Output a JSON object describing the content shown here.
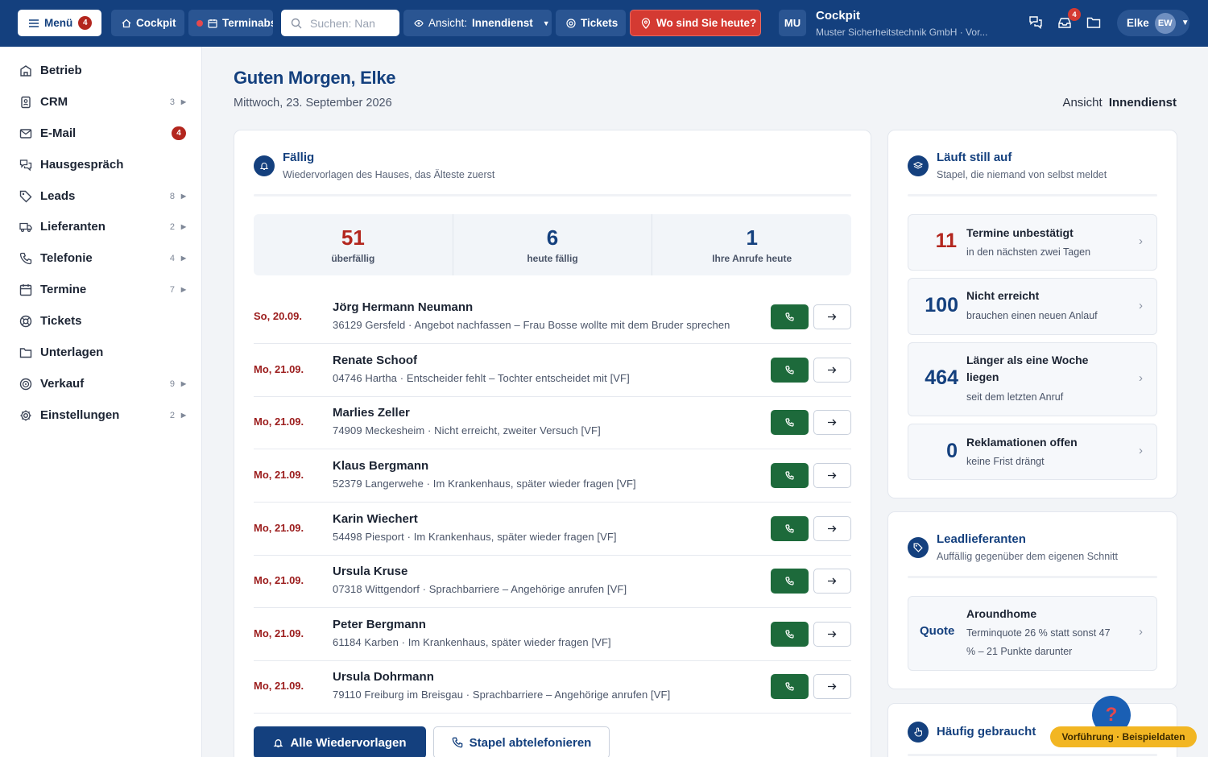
{
  "topbar": {
    "menu_label": "Menü",
    "menu_badge": "4",
    "cockpit_label": "Cockpit",
    "terminals_label": "Terminabs",
    "search_placeholder": "Suchen: Nan",
    "view_prefix": "Ansicht:",
    "view_value": "Innendienst",
    "tickets_label": "Tickets",
    "where_label": "Wo sind Sie heute?",
    "brand_initials": "MU",
    "brand_title": "Cockpit",
    "brand_subtitle": "Muster Sicherheitstechnik GmbH · Vor...",
    "inbox_badge": "4",
    "user_name": "Elke",
    "user_initials": "EW",
    "accent_color": "#14407e",
    "alert_color": "#d43a32"
  },
  "sidebar": {
    "items": [
      {
        "label": "Betrieb",
        "icon": "building-icon",
        "count": "",
        "badge": ""
      },
      {
        "label": "CRM",
        "icon": "contacts-icon",
        "count": "3",
        "badge": ""
      },
      {
        "label": "E-Mail",
        "icon": "mail-icon",
        "count": "",
        "badge": "4"
      },
      {
        "label": "Hausgespräch",
        "icon": "chat-icon",
        "count": "",
        "badge": ""
      },
      {
        "label": "Leads",
        "icon": "tag-icon",
        "count": "8",
        "badge": ""
      },
      {
        "label": "Lieferanten",
        "icon": "truck-icon",
        "count": "2",
        "badge": ""
      },
      {
        "label": "Telefonie",
        "icon": "phone-icon",
        "count": "4",
        "badge": ""
      },
      {
        "label": "Termine",
        "icon": "calendar-icon",
        "count": "7",
        "badge": ""
      },
      {
        "label": "Tickets",
        "icon": "lifebuoy-icon",
        "count": "",
        "badge": ""
      },
      {
        "label": "Unterlagen",
        "icon": "folder-icon",
        "count": "",
        "badge": ""
      },
      {
        "label": "Verkauf",
        "icon": "target-icon",
        "count": "9",
        "badge": ""
      },
      {
        "label": "Einstellungen",
        "icon": "gear-icon",
        "count": "2",
        "badge": ""
      }
    ]
  },
  "main": {
    "greeting": "Guten Morgen, Elke",
    "date": "Mittwoch, 23. September 2026",
    "view_label": "Ansicht",
    "view_value": "Innendienst"
  },
  "due": {
    "title": "Fällig",
    "subtitle": "Wiedervorlagen des Hauses, das Älteste zuerst",
    "stats": [
      {
        "value": "51",
        "label": "überfällig"
      },
      {
        "value": "6",
        "label": "heute fällig"
      },
      {
        "value": "1",
        "label": "Ihre Anrufe heute"
      }
    ],
    "rows": [
      {
        "date": "So, 20.09.",
        "name": "Jörg Hermann Neumann",
        "desc": "36129 Gersfeld · Angebot nachfassen – Frau Bosse wollte mit dem Bruder sprechen"
      },
      {
        "date": "Mo, 21.09.",
        "name": "Renate Schoof",
        "desc": "04746 Hartha · Entscheider fehlt – Tochter entscheidet mit [VF]"
      },
      {
        "date": "Mo, 21.09.",
        "name": "Marlies Zeller",
        "desc": "74909 Meckesheim · Nicht erreicht, zweiter Versuch [VF]"
      },
      {
        "date": "Mo, 21.09.",
        "name": "Klaus Bergmann",
        "desc": "52379 Langerwehe · Im Krankenhaus, später wieder fragen [VF]"
      },
      {
        "date": "Mo, 21.09.",
        "name": "Karin Wiechert",
        "desc": "54498 Piesport · Im Krankenhaus, später wieder fragen [VF]"
      },
      {
        "date": "Mo, 21.09.",
        "name": "Ursula Kruse",
        "desc": "07318 Wittgendorf · Sprachbarriere – Angehörige anrufen [VF]"
      },
      {
        "date": "Mo, 21.09.",
        "name": "Peter Bergmann",
        "desc": "61184 Karben · Im Krankenhaus, später wieder fragen [VF]"
      },
      {
        "date": "Mo, 21.09.",
        "name": "Ursula Dohrmann",
        "desc": "79110 Freiburg im Breisgau · Sprachbarriere – Angehörige anrufen [VF]"
      }
    ],
    "btn_all": "Alle Wiedervorlagen",
    "btn_batch": "Stapel abtelefonieren"
  },
  "silent": {
    "title": "Läuft still auf",
    "subtitle": "Stapel, die niemand von selbst meldet",
    "tiles": [
      {
        "num": "11",
        "title": "Termine unbestätigt",
        "sub": "in den nächsten zwei Tagen"
      },
      {
        "num": "100",
        "title": "Nicht erreicht",
        "sub": "brauchen einen neuen Anlauf"
      },
      {
        "num": "464",
        "title1": "Länger als eine Woche",
        "title2": "liegen",
        "sub": "seit dem letzten Anruf"
      },
      {
        "num": "0",
        "title": "Reklamationen offen",
        "sub": "keine Frist drängt"
      }
    ]
  },
  "suppliers": {
    "title": "Leadlieferanten",
    "subtitle": "Auffällig gegenüber dem eigenen Schnitt",
    "tile": {
      "label": "Quote",
      "title": "Aroundhome",
      "sub1": "Terminquote 26 % statt sonst 47",
      "sub2": "% – 21 Punkte darunter"
    }
  },
  "frequent": {
    "title": "Häufig gebraucht"
  },
  "floating": {
    "help": "?",
    "demo": "Vorführung · Beispieldaten"
  }
}
